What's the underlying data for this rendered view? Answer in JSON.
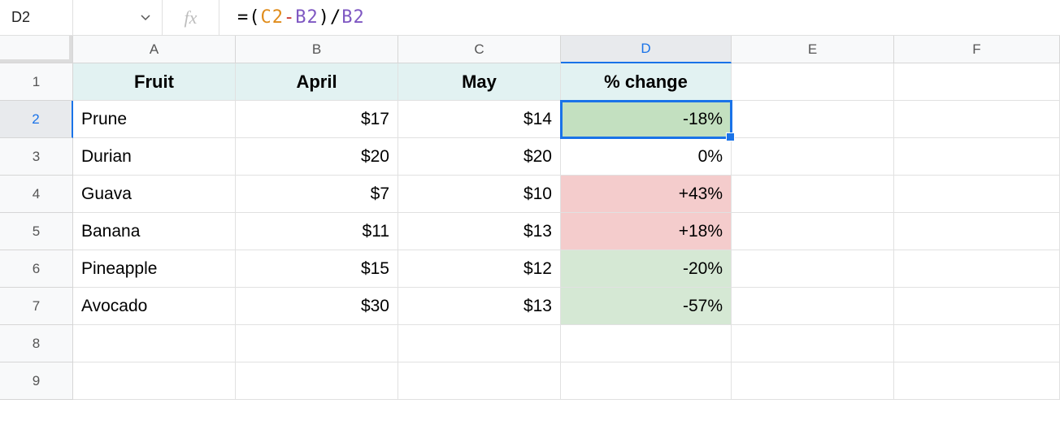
{
  "formula_bar": {
    "cell_ref": "D2",
    "fx_label": "fx",
    "formula_tokens": {
      "eq": "=",
      "lp": "(",
      "c2": "C2",
      "minus": "-",
      "b2a": "B2",
      "rp": ")",
      "slash": "/",
      "b2b": "B2"
    }
  },
  "columns": {
    "A": "A",
    "B": "B",
    "C": "C",
    "D": "D",
    "E": "E",
    "F": "F"
  },
  "row_labels": {
    "r1": "1",
    "r2": "2",
    "r3": "3",
    "r4": "4",
    "r5": "5",
    "r6": "6",
    "r7": "7",
    "r8": "8",
    "r9": "9"
  },
  "headers": {
    "A": "Fruit",
    "B": "April",
    "C": "May",
    "D": "% change"
  },
  "rows": [
    {
      "fruit": "Prune",
      "april": "$17",
      "may": "$14",
      "pct": "-18%",
      "pct_bg": "green-sel",
      "selected": true
    },
    {
      "fruit": "Durian",
      "april": "$20",
      "may": "$20",
      "pct": "0%",
      "pct_bg": ""
    },
    {
      "fruit": "Guava",
      "april": "$7",
      "may": "$10",
      "pct": "+43%",
      "pct_bg": "red"
    },
    {
      "fruit": "Banana",
      "april": "$11",
      "may": "$13",
      "pct": "+18%",
      "pct_bg": "red"
    },
    {
      "fruit": "Pineapple",
      "april": "$15",
      "may": "$12",
      "pct": "-20%",
      "pct_bg": "green"
    },
    {
      "fruit": "Avocado",
      "april": "$30",
      "may": "$13",
      "pct": "-57%",
      "pct_bg": "green"
    }
  ]
}
